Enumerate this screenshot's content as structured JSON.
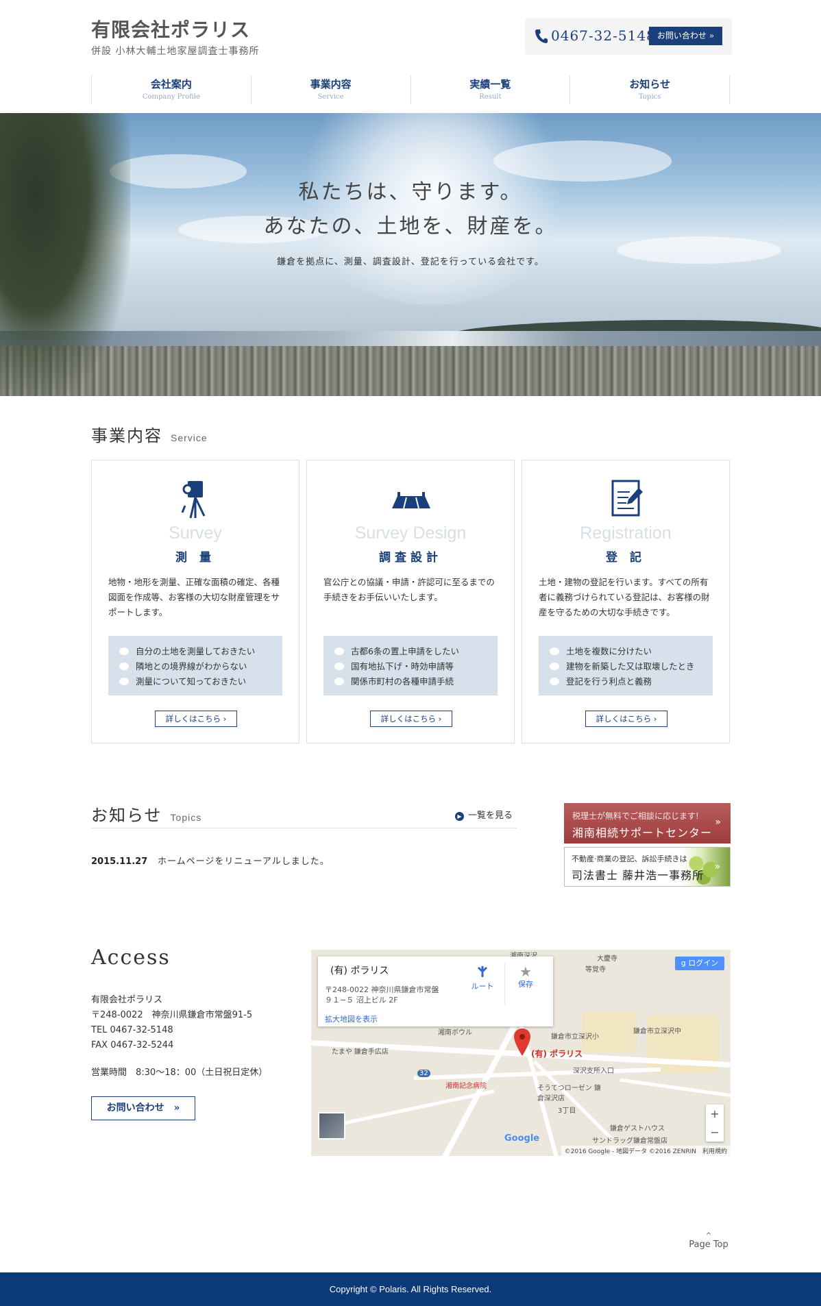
{
  "header": {
    "company_name": "有限会社ポラリス",
    "company_sub": "併設 小林大輔土地家屋調査士事務所",
    "phone": "0467-32-5148",
    "inquiry_button": "お問い合わせ »"
  },
  "nav": {
    "items": [
      {
        "jp": "会社案内",
        "en": "Company Profile"
      },
      {
        "jp": "事業内容",
        "en": "Service"
      },
      {
        "jp": "実績一覧",
        "en": "Result"
      },
      {
        "jp": "お知らせ",
        "en": "Topics"
      }
    ]
  },
  "hero": {
    "line1": "私たちは、守ります。",
    "line2": "あなたの、土地を、財産を。",
    "line3": "鎌倉を拠点に、測量、調査設計、登記を行っている会社です。"
  },
  "service": {
    "title": "事業内容",
    "subtitle": "Service",
    "cards": [
      {
        "icon": "surveying-instrument-icon",
        "en": "Survey",
        "jp": "測 量",
        "desc": "地物・地形を測量、正確な面積の確定、各種図面を作成等、お客様の大切な財産管理をサポートします。",
        "items": [
          "自分の土地を測量しておきたい",
          "隣地との境界線がわからない",
          "測量について知っておきたい"
        ],
        "button": "詳しくはこちら ›"
      },
      {
        "icon": "bridge-design-icon",
        "en": "Survey Design",
        "jp": "調査設計",
        "desc": "官公庁との協議・申請・許認可に至るまでの手続きをお手伝いいたします。",
        "items": [
          "古都6条の置上申請をしたい",
          "国有地払下げ・時効申請等",
          "関係市町村の各種申請手続"
        ],
        "button": "詳しくはこちら ›"
      },
      {
        "icon": "document-edit-icon",
        "en": "Registration",
        "jp": "登 記",
        "desc": "土地・建物の登記を行います。すべての所有者に義務づけられている登記は、お客様の財産を守るための大切な手続きです。",
        "items": [
          "土地を複数に分けたい",
          "建物を新築した又は取壊したとき",
          "登記を行う利点と義務"
        ],
        "button": "詳しくはこちら ›"
      }
    ]
  },
  "topics": {
    "title": "お知らせ",
    "subtitle": "Topics",
    "list_link": "一覧を見る",
    "news": [
      {
        "date": "2015.11.27",
        "text": "ホームページをリニューアルしました。"
      }
    ]
  },
  "banners": {
    "b1_small": "税理士が無料でご相談に応じます!",
    "b1_big": "湘南相続サポートセンター",
    "b2_small": "不動産·商業の登記、訴訟手続きは",
    "b2_big": "司法書士 藤井浩一事務所"
  },
  "access": {
    "title": "Access",
    "name": "有限会社ポラリス",
    "address": "〒248-0022　神奈川県鎌倉市常盤91-5",
    "tel": "TEL 0467-32-5148",
    "fax": "FAX 0467-32-5244",
    "hours": "営業時間　8:30〜18：00（土日祝日定休）",
    "button": "お問い合わせ　»"
  },
  "map": {
    "place_name": "(有) ポラリス",
    "addr1": "〒248-0022 神奈川県鎌倉市常盤",
    "addr2": "９１−５ 沼上ビル 2F",
    "enlarge_link": "拡大地図を表示",
    "route": "ルート",
    "save": "保存",
    "login": "ログイン",
    "pin_label": "(有) ポラリス",
    "labels": {
      "l1": "湘南深沢",
      "l2": "大慶寺",
      "l3": "等覚寺",
      "l4": "鎌倉市立深沢中",
      "l5": "鎌倉市立深沢小",
      "l6": "湘南ボウル",
      "l7": "たまや 鎌倉手広店",
      "l8": "湘南記念病院",
      "l9": "深沢支所入口",
      "l10": "そうてつローゼン 鎌倉深沢店",
      "l11": "3丁目",
      "l12": "鎌倉ゲストハウス",
      "l13": "サンドラッグ鎌倉常盤店",
      "l14": "32"
    },
    "google": "Google",
    "copyright": "©2016 Google - 地図データ ©2016 ZENRIN　利用規約"
  },
  "page_top": "Page Top",
  "footer": "Copyright © Polaris. All Rights Reserved.",
  "colors": {
    "brand": "#1a3f7a",
    "footer": "#0c3a78",
    "banner_red": "#9e3c3c"
  }
}
